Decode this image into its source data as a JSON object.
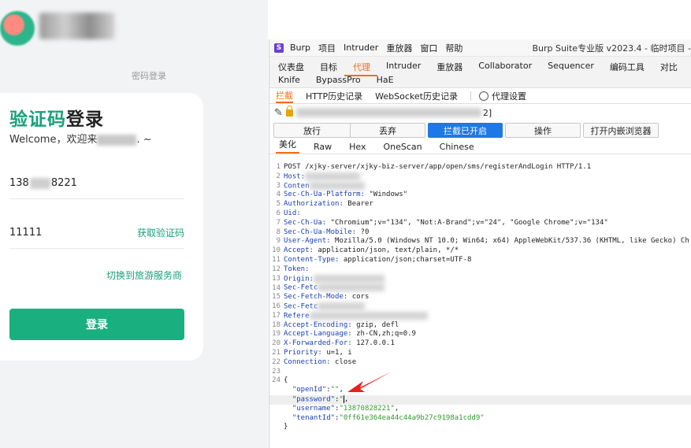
{
  "login": {
    "password_login": "密码登录",
    "title_accent": "验证码",
    "title_rest": "登录",
    "welcome_prefix": "Welcome，欢迎来",
    "welcome_suffix": ". ~",
    "phone_start": "138",
    "phone_end": "8221",
    "code_value": "11111",
    "get_code": "获取验证码",
    "switch_provider": "切换到旅游服务商",
    "login_button": "登录"
  },
  "burp": {
    "app_icon": "S",
    "menu": [
      "Burp",
      "项目",
      "Intruder",
      "重放器",
      "窗口",
      "帮助"
    ],
    "window_title": "Burp Suite专业版  v2023.4 - 临时项目 -",
    "tabs_row1": [
      "仪表盘",
      "目标",
      "代理",
      "Intruder",
      "重放器",
      "Collaborator",
      "Sequencer",
      "编码工具",
      "对比"
    ],
    "tabs_row2": [
      "Knife",
      "BypassPro",
      "HaE"
    ],
    "active_tab": "代理",
    "proxy_tabs": [
      "拦截",
      "HTTP历史记录",
      "WebSocket历史记录"
    ],
    "proxy_settings": "代理设置",
    "url_tail": "2]",
    "buttons": {
      "forward": "放行",
      "drop": "丢弃",
      "intercept_on": "拦截已开启",
      "action": "操作",
      "open_browser": "打开内嵌浏览器"
    },
    "sub_tabs": [
      "美化",
      "Raw",
      "Hex",
      "OneScan",
      "Chinese"
    ],
    "request_line": "POST /xjky-server/xjky-biz-server/app/open/sms/registerAndLogin HTTP/1.1",
    "headers": [
      {
        "n": "2",
        "key": "Host:",
        "val": ""
      },
      {
        "n": "3",
        "key": "Conten",
        "val": ""
      },
      {
        "n": "4",
        "key": "Sec-Ch-Ua-Platform:",
        "val": " \"Windows\""
      },
      {
        "n": "5",
        "key": "Authorization:",
        "val": " Bearer"
      },
      {
        "n": "6",
        "key": "Uid:",
        "val": ""
      },
      {
        "n": "7",
        "key": "Sec-Ch-Ua:",
        "val": " \"Chromium\";v=\"134\", \"Not:A-Brand\";v=\"24\", \"Google Chrome\";v=\"134\""
      },
      {
        "n": "8",
        "key": "Sec-Ch-Ua-Mobile:",
        "val": " ?0"
      },
      {
        "n": "9",
        "key": "User-Agent:",
        "val": " Mozilla/5.0 (Windows NT 10.0; Win64; x64) AppleWebKit/537.36 (KHTML, like Gecko) Ch"
      },
      {
        "n": "10",
        "key": "Accept:",
        "val": " application/json, text/plain, */*"
      },
      {
        "n": "11",
        "key": "Content-Type:",
        "val": " application/json;charset=UTF-8"
      },
      {
        "n": "12",
        "key": "Token:",
        "val": ""
      },
      {
        "n": "13",
        "key": "Origin:",
        "val": ""
      },
      {
        "n": "14",
        "key": "Sec-Fetc",
        "val": ""
      },
      {
        "n": "15",
        "key": "Sec-Fetch-Mode:",
        "val": " cors"
      },
      {
        "n": "16",
        "key": "Sec-Fetc",
        "val": ""
      },
      {
        "n": "17",
        "key": "Refere",
        "val": ""
      },
      {
        "n": "18",
        "key": "Accept-Encoding:",
        "val": " gzip, defl"
      },
      {
        "n": "19",
        "key": "Accept-Language:",
        "val": " zh-CN,zh;q=0.9"
      },
      {
        "n": "20",
        "key": "X-Forwarded-For:",
        "val": " 127.0.0.1"
      },
      {
        "n": "21",
        "key": "Priority:",
        "val": " u=1, i"
      },
      {
        "n": "22",
        "key": "Connection:",
        "val": " close"
      }
    ],
    "body": {
      "open_brace": "{",
      "close_brace": "}",
      "openid_key": "\"openId\"",
      "openid_val": "\"\"",
      "password_key": "\"password\"",
      "password_val": "\"",
      "username_key": "\"username\"",
      "username_val": "\"13870828221\"",
      "tenant_key": "\"tenantId\"",
      "tenant_val": "\"0ff61e364ea44c44a9b27c9198a1cdd9\""
    },
    "arrow_color": "#e8211d"
  }
}
